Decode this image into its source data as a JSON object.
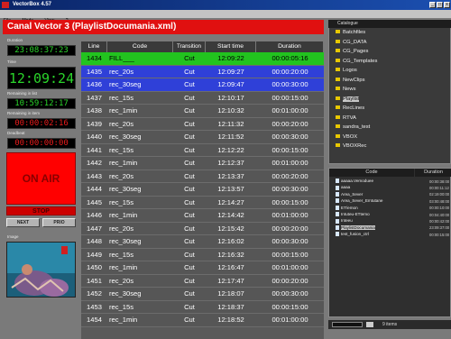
{
  "window": {
    "title": "VectorBox 4.57",
    "menu": [
      "File",
      "Mode",
      "View",
      "?"
    ],
    "buttons": [
      "_",
      "□",
      "x"
    ]
  },
  "channel_header": "Canal Vector 3  (PlaylistDocumania.xml)",
  "left": {
    "duration_label": "Duration",
    "duration": "23:08:37:23",
    "time_label": "Time",
    "time": "12:09:24",
    "remaining_list_label": "Remaining in list",
    "remaining_list": "10:59:12:17",
    "remaining_item_label": "Remaining in item",
    "remaining_item": "00:00:02:16",
    "deadbeat_label": "Deadbeat",
    "deadbeat": "00:00:00:00",
    "onair": "ON AIR",
    "stop": "STOP",
    "next": "NEXT",
    "prio": "PRIO",
    "image_label": "Image"
  },
  "table": {
    "columns": [
      "Line",
      "Code",
      "Transition",
      "Start time",
      "Duration"
    ],
    "rows": [
      {
        "line": "1434",
        "code": "FILL___",
        "transition": "Cut",
        "start": "12:09:22",
        "duration": "00:00:05:16",
        "state": "playing"
      },
      {
        "line": "1435",
        "code": "rec_20s",
        "transition": "Cut",
        "start": "12:09:27",
        "duration": "00:00:20:00",
        "state": "selected"
      },
      {
        "line": "1436",
        "code": "rec_30seg",
        "transition": "Cut",
        "start": "12:09:47",
        "duration": "00:00:30:00",
        "state": "selected"
      },
      {
        "line": "1437",
        "code": "rec_15s",
        "transition": "Cut",
        "start": "12:10:17",
        "duration": "00:00:15:00",
        "state": "normal"
      },
      {
        "line": "1438",
        "code": "rec_1min",
        "transition": "Cut",
        "start": "12:10:32",
        "duration": "00:01:00:00",
        "state": "normal"
      },
      {
        "line": "1439",
        "code": "rec_20s",
        "transition": "Cut",
        "start": "12:11:32",
        "duration": "00:00:20:00",
        "state": "normal"
      },
      {
        "line": "1440",
        "code": "rec_30seg",
        "transition": "Cut",
        "start": "12:11:52",
        "duration": "00:00:30:00",
        "state": "normal"
      },
      {
        "line": "1441",
        "code": "rec_15s",
        "transition": "Cut",
        "start": "12:12:22",
        "duration": "00:00:15:00",
        "state": "normal"
      },
      {
        "line": "1442",
        "code": "rec_1min",
        "transition": "Cut",
        "start": "12:12:37",
        "duration": "00:01:00:00",
        "state": "normal"
      },
      {
        "line": "1443",
        "code": "rec_20s",
        "transition": "Cut",
        "start": "12:13:37",
        "duration": "00:00:20:00",
        "state": "normal"
      },
      {
        "line": "1444",
        "code": "rec_30seg",
        "transition": "Cut",
        "start": "12:13:57",
        "duration": "00:00:30:00",
        "state": "normal"
      },
      {
        "line": "1445",
        "code": "rec_15s",
        "transition": "Cut",
        "start": "12:14:27",
        "duration": "00:00:15:00",
        "state": "normal"
      },
      {
        "line": "1446",
        "code": "rec_1min",
        "transition": "Cut",
        "start": "12:14:42",
        "duration": "00:01:00:00",
        "state": "normal"
      },
      {
        "line": "1447",
        "code": "rec_20s",
        "transition": "Cut",
        "start": "12:15:42",
        "duration": "00:00:20:00",
        "state": "normal"
      },
      {
        "line": "1448",
        "code": "rec_30seg",
        "transition": "Cut",
        "start": "12:16:02",
        "duration": "00:00:30:00",
        "state": "normal"
      },
      {
        "line": "1449",
        "code": "rec_15s",
        "transition": "Cut",
        "start": "12:16:32",
        "duration": "00:00:15:00",
        "state": "normal"
      },
      {
        "line": "1450",
        "code": "rec_1min",
        "transition": "Cut",
        "start": "12:16:47",
        "duration": "00:01:00:00",
        "state": "normal"
      },
      {
        "line": "1451",
        "code": "rec_20s",
        "transition": "Cut",
        "start": "12:17:47",
        "duration": "00:00:20:00",
        "state": "normal"
      },
      {
        "line": "1452",
        "code": "rec_30seg",
        "transition": "Cut",
        "start": "12:18:07",
        "duration": "00:00:30:00",
        "state": "normal"
      },
      {
        "line": "1453",
        "code": "rec_15s",
        "transition": "Cut",
        "start": "12:18:37",
        "duration": "00:00:15:00",
        "state": "normal"
      },
      {
        "line": "1454",
        "code": "rec_1min",
        "transition": "Cut",
        "start": "12:18:52",
        "duration": "00:01:00:00",
        "state": "normal"
      }
    ]
  },
  "catalogue": {
    "title": "Catalogue",
    "folders": [
      "Batchfiles",
      "CG_DATA",
      "CG_Pages",
      "CG_Templates",
      "Logos",
      "NewClips",
      "News",
      "Playlist",
      "RecLines",
      "RTVA",
      "sandra_test",
      "VBOX",
      "VBOXRec"
    ],
    "selected": "Playlist"
  },
  "filelist": {
    "columns": [
      "Code",
      "Duration"
    ],
    "items": [
      {
        "code": "aaaaa.Vemoduee",
        "duration": "00:00:38:00"
      },
      {
        "code": "aaaa",
        "duration": "00:00:11:12"
      },
      {
        "code": "Area_Sever",
        "duration": "02:19:00:00"
      },
      {
        "code": "Area_Sever_Emtutane",
        "duration": "03:00:48:00"
      },
      {
        "code": "ET/emon",
        "duration": "00:00:10:00"
      },
      {
        "code": "Intuteu-ETtemo",
        "duration": "00:04:40:00"
      },
      {
        "code": "Inteeu",
        "duration": "00:00:42:00"
      },
      {
        "code": "PlaylistDocumania",
        "duration": "23:09:37:00"
      },
      {
        "code": "test_fusion_ctrl",
        "duration": "00:00:15:00"
      }
    ],
    "selected": "PlaylistDocumania"
  },
  "footer": {
    "items_text": "9 items"
  },
  "colors": {
    "header_red": "#e01010",
    "playing_green": "#22c31f",
    "selected_blue": "#2f40d8",
    "row_gray": "#565656",
    "lcd_green": "#2ad42a",
    "lcd_red": "#e81b1b"
  }
}
